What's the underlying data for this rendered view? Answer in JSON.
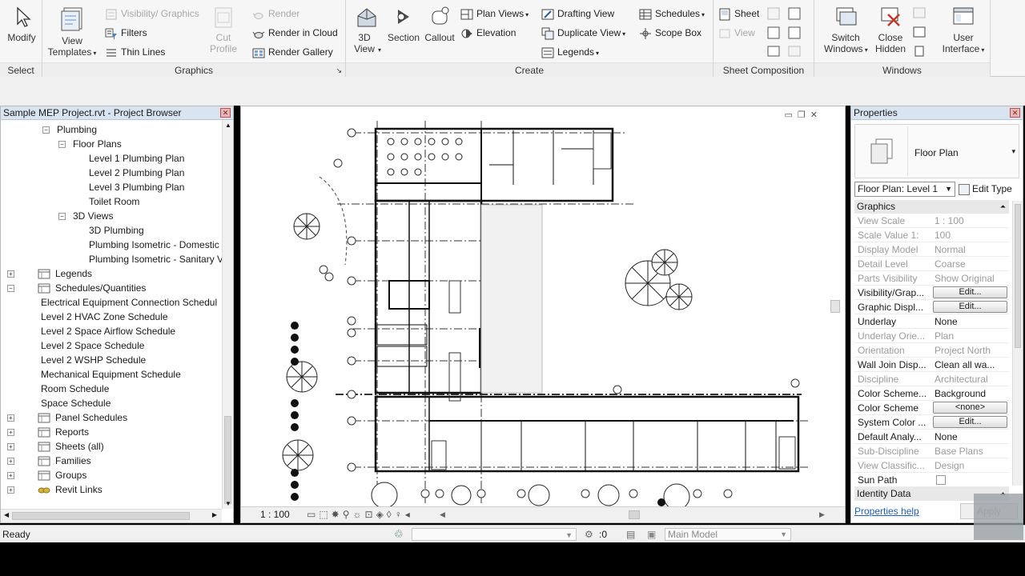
{
  "ribbon": {
    "select": {
      "modify": "Modify",
      "panel": "Select"
    },
    "graphics": {
      "view_templates": "View Templates",
      "visibility": "Visibility/ Graphics",
      "filters": "Filters",
      "thin_lines": "Thin Lines",
      "cut_profile": "Cut Profile",
      "render": "Render",
      "render_cloud": "Render in Cloud",
      "render_gallery": "Render Gallery",
      "panel": "Graphics"
    },
    "create": {
      "view_3d": "3D View",
      "section": "Section",
      "callout": "Callout",
      "plan_views": "Plan Views",
      "elevation": "Elevation",
      "drafting_view": "Drafting View",
      "duplicate_view": "Duplicate View",
      "legends": "Legends",
      "schedules": "Schedules",
      "scope_box": "Scope Box",
      "panel": "Create"
    },
    "sheet": {
      "sheet": "Sheet",
      "view": "View",
      "panel": "Sheet Composition"
    },
    "windows": {
      "switch_windows": "Switch Windows",
      "close_hidden": "Close Hidden",
      "user_interface": "User Interface",
      "panel": "Windows"
    }
  },
  "browser": {
    "title": "Sample MEP Project.rvt - Project Browser",
    "items": [
      {
        "label": "Plumbing",
        "toggle": "−"
      },
      {
        "label": "Floor Plans",
        "toggle": "−"
      },
      {
        "label": "Level 1 Plumbing Plan"
      },
      {
        "label": "Level 2 Plumbing Plan"
      },
      {
        "label": "Level 3 Plumbing Plan"
      },
      {
        "label": "Toilet Room"
      },
      {
        "label": "3D Views",
        "toggle": "−"
      },
      {
        "label": "3D Plumbing"
      },
      {
        "label": "Plumbing Isometric - Domestic"
      },
      {
        "label": "Plumbing Isometric - Sanitary V"
      },
      {
        "label": "Legends",
        "toggle": "+"
      },
      {
        "label": "Schedules/Quantities",
        "toggle": "−"
      },
      {
        "label": "Electrical Equipment Connection Schedul"
      },
      {
        "label": "Level 2 HVAC Zone Schedule"
      },
      {
        "label": "Level 2 Space Airflow Schedule"
      },
      {
        "label": "Level 2 Space Schedule"
      },
      {
        "label": "Level 2 WSHP Schedule"
      },
      {
        "label": "Mechanical Equipment Schedule"
      },
      {
        "label": "Room Schedule"
      },
      {
        "label": "Space Schedule"
      },
      {
        "label": "Panel Schedules",
        "toggle": "+"
      },
      {
        "label": "Reports",
        "toggle": "+"
      },
      {
        "label": "Sheets (all)",
        "toggle": "+"
      },
      {
        "label": "Families",
        "toggle": "+"
      },
      {
        "label": "Groups",
        "toggle": "+"
      },
      {
        "label": "Revit Links",
        "toggle": "+"
      }
    ]
  },
  "view": {
    "scale": "1 : 100"
  },
  "properties": {
    "title": "Properties",
    "type_name": "Floor Plan",
    "selector": "Floor Plan: Level 1",
    "edit_type": "Edit Type",
    "section_graphics": "Graphics",
    "rows": [
      {
        "k": "View Scale",
        "v": "1 : 100",
        "grey": true
      },
      {
        "k": "Scale Value   1:",
        "v": "100",
        "grey": true
      },
      {
        "k": "Display Model",
        "v": "Normal",
        "grey": true
      },
      {
        "k": "Detail Level",
        "v": "Coarse",
        "grey": true
      },
      {
        "k": "Parts Visibility",
        "v": "Show Original",
        "grey": true
      },
      {
        "k": "Visibility/Grap...",
        "v": "Edit...",
        "btn": true
      },
      {
        "k": "Graphic Displ...",
        "v": "Edit...",
        "btn": true
      },
      {
        "k": "Underlay",
        "v": "None"
      },
      {
        "k": "Underlay Orie...",
        "v": "Plan",
        "grey": true
      },
      {
        "k": "Orientation",
        "v": "Project North",
        "grey": true
      },
      {
        "k": "Wall Join Disp...",
        "v": "Clean all wa..."
      },
      {
        "k": "Discipline",
        "v": "Architectural",
        "grey": true
      },
      {
        "k": "Color Scheme...",
        "v": "Background"
      },
      {
        "k": "Color Scheme",
        "v": "<none>",
        "btn": true
      },
      {
        "k": "System Color ...",
        "v": "Edit...",
        "btn": true
      },
      {
        "k": "Default Analy...",
        "v": "None"
      },
      {
        "k": "Sub-Discipline",
        "v": "Base Plans",
        "grey": true
      },
      {
        "k": "View Classific...",
        "v": "Design",
        "grey": true
      },
      {
        "k": "Sun Path",
        "v": ""
      }
    ],
    "section_identity": "Identity Data",
    "help": "Properties help",
    "apply": "Apply"
  },
  "status": {
    "ready": "Ready",
    "count": ":0",
    "model": "Main Model"
  }
}
